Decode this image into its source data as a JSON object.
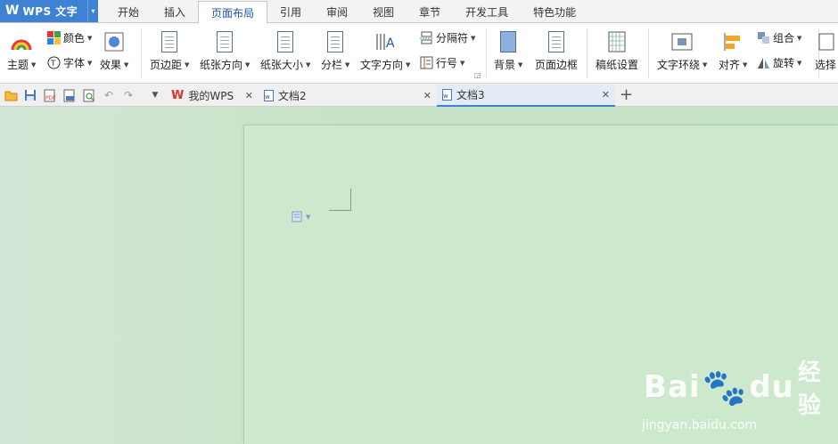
{
  "app": {
    "logo_letter": "W",
    "title": "WPS 文字",
    "caret": "▾"
  },
  "menu": {
    "tabs": [
      {
        "label": "开始"
      },
      {
        "label": "插入"
      },
      {
        "label": "页面布局"
      },
      {
        "label": "引用"
      },
      {
        "label": "审阅"
      },
      {
        "label": "视图"
      },
      {
        "label": "章节"
      },
      {
        "label": "开发工具"
      },
      {
        "label": "特色功能"
      }
    ]
  },
  "ribbon": {
    "theme": "主题",
    "color": "颜色",
    "font": "字体",
    "effect": "效果",
    "margin": "页边距",
    "orientation": "纸张方向",
    "size": "纸张大小",
    "columns": "分栏",
    "text_direction": "文字方向",
    "breaks": "分隔符",
    "line_numbers": "行号",
    "background": "背景",
    "page_border": "页面边框",
    "manuscript": "稿纸设置",
    "wrap_text": "文字环绕",
    "align": "对齐",
    "group": "组合",
    "rotate": "旋转",
    "select": "选择"
  },
  "doc_tabs": [
    {
      "label": "我的WPS",
      "active": false
    },
    {
      "label": "文档2",
      "active": false
    },
    {
      "label": "文档3",
      "active": true
    }
  ],
  "watermark": {
    "brand_a": "Bai",
    "brand_b": "du",
    "brand_c": "经验",
    "url": "jingyan.baidu.com"
  },
  "colors": {
    "accent": "#3f82d4",
    "canvas": "#c8e4c8",
    "page": "#cde9cd"
  }
}
